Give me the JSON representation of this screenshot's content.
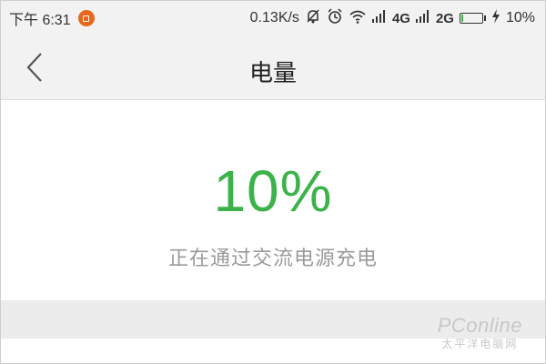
{
  "status_bar": {
    "time": "下午 6:31",
    "net_speed": "0.13K/s",
    "net1": "4G",
    "net2": "2G",
    "battery": "10%",
    "battery_level": 0.1,
    "icons": [
      "notification-icon",
      "mute-icon",
      "alarm-icon",
      "wifi-icon",
      "signal-icon",
      "charging-icon"
    ]
  },
  "header": {
    "title": "电量"
  },
  "main": {
    "percent": "10%",
    "status": "正在通过交流电源充电"
  },
  "watermark": {
    "main": "PConline",
    "sub": "太平洋电脑网"
  },
  "colors": {
    "accent": "#3cb34a",
    "status_text": "#9a9a9a",
    "header_bg": "#f2f2f2",
    "band_bg": "#ececec",
    "badge": "#e8671a"
  }
}
